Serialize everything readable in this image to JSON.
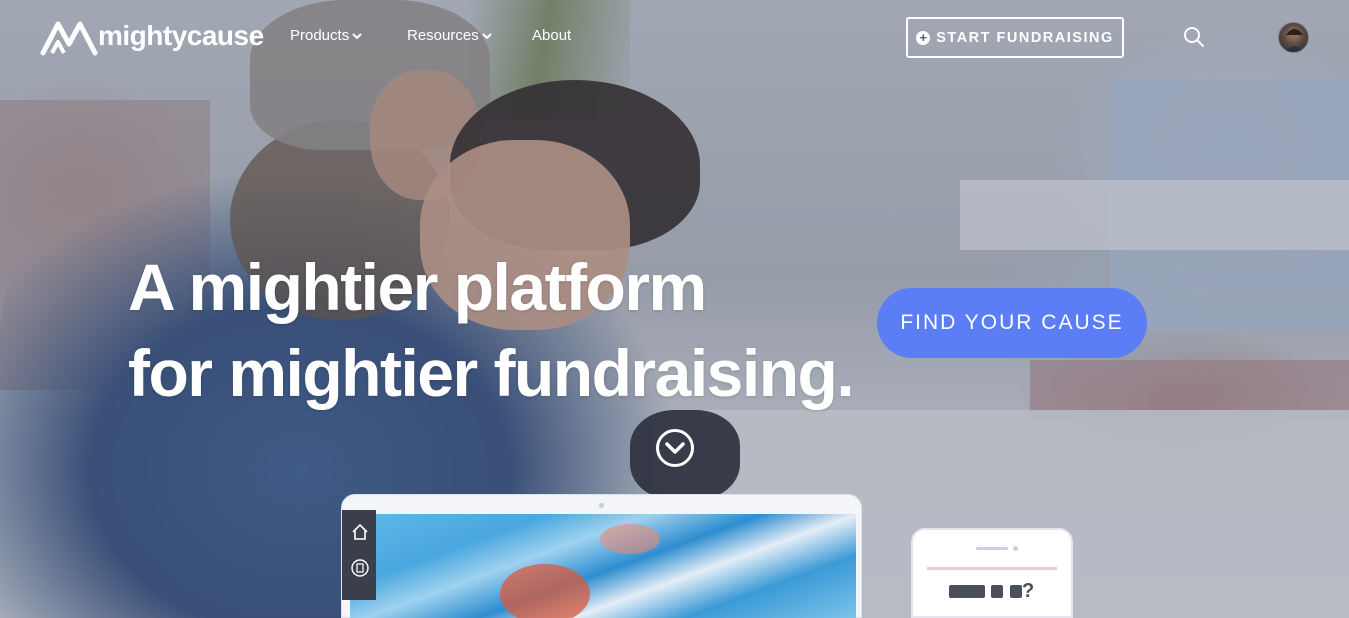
{
  "brand": {
    "name": "mightycause",
    "logo_icon": "mountain-m-icon"
  },
  "nav": {
    "items": [
      {
        "label": "Products",
        "has_dropdown": true
      },
      {
        "label": "Resources",
        "has_dropdown": true
      },
      {
        "label": "About",
        "has_dropdown": false
      }
    ],
    "cta_label": "START FUNDRAISING",
    "search_icon": "search-icon",
    "avatar_icon": "user-avatar"
  },
  "hero": {
    "headline_line1": "A mightier platform",
    "headline_line2": "for mightier fundraising.",
    "button_label": "FIND YOUR CAUSE",
    "scroll_icon": "chevron-down-circle-icon"
  },
  "devices": {
    "phone_text": "?"
  },
  "colors": {
    "accent": "#5b7ef6",
    "text_light": "#ffffff"
  }
}
